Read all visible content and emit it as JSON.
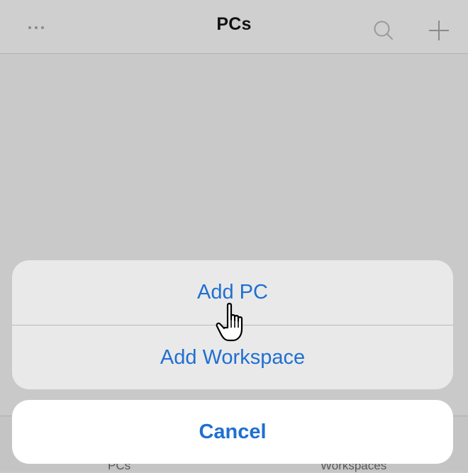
{
  "nav": {
    "title": "PCs",
    "more_icon": "ellipsis-icon",
    "search_icon": "search-icon",
    "add_icon": "plus-icon"
  },
  "action_sheet": {
    "items": [
      {
        "label": "Add PC"
      },
      {
        "label": "Add Workspace"
      }
    ],
    "cancel_label": "Cancel"
  },
  "tabbar": {
    "tabs": [
      {
        "label": "PCs"
      },
      {
        "label": "Workspaces"
      }
    ]
  },
  "colors": {
    "accent": "#1f6fd1",
    "dim_background": "#c9c9c9",
    "sheet_background": "#e9e9e9"
  }
}
